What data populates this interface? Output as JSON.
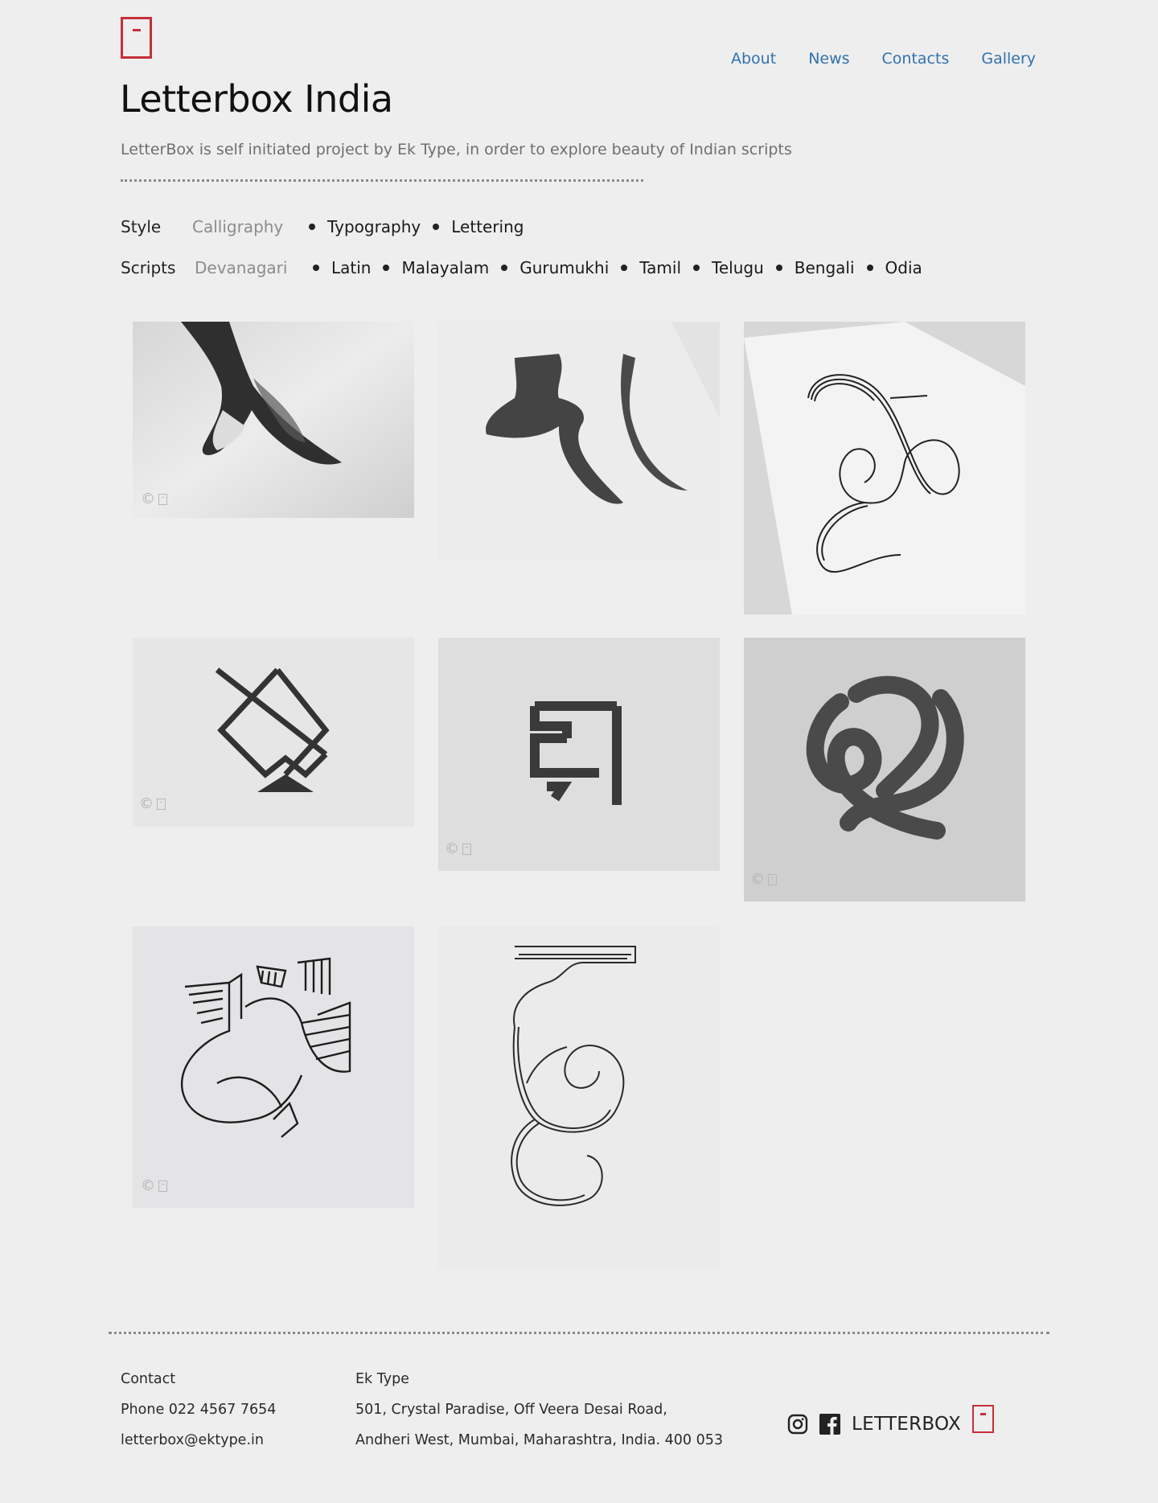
{
  "header": {
    "title": "Letterbox India",
    "subtitle": "LetterBox is self initiated project by Ek Type, in order to explore beauty of Indian scripts"
  },
  "nav": {
    "items": [
      {
        "label": "About"
      },
      {
        "label": "News"
      },
      {
        "label": "Contacts"
      },
      {
        "label": "Gallery"
      }
    ]
  },
  "filters": {
    "style": {
      "label": "Style",
      "active": "Calligraphy",
      "options": [
        "Typography",
        "Lettering"
      ]
    },
    "scripts": {
      "label": "Scripts",
      "active": "Devanagari",
      "options": [
        "Latin",
        "Malayalam",
        "Gurumukhi",
        "Tamil",
        "Telugu",
        "Bengali",
        "Odia"
      ]
    }
  },
  "gallery": {
    "copyright_symbol": "©"
  },
  "footer": {
    "contact": {
      "heading": "Contact",
      "phone": "Phone 022 4567 7654",
      "email": "letterbox@ektype.in"
    },
    "address": {
      "company": "Ek Type",
      "line1": "501, Crystal Paradise, Off Veera Desai Road,",
      "line2": "Andheri West, Mumbai, Maharashtra, India. 400 053"
    },
    "brand": "LETTERBOX"
  },
  "colors": {
    "background": "#efeeee",
    "brand_red": "#c62f38",
    "nav_link": "#2f72b0"
  }
}
